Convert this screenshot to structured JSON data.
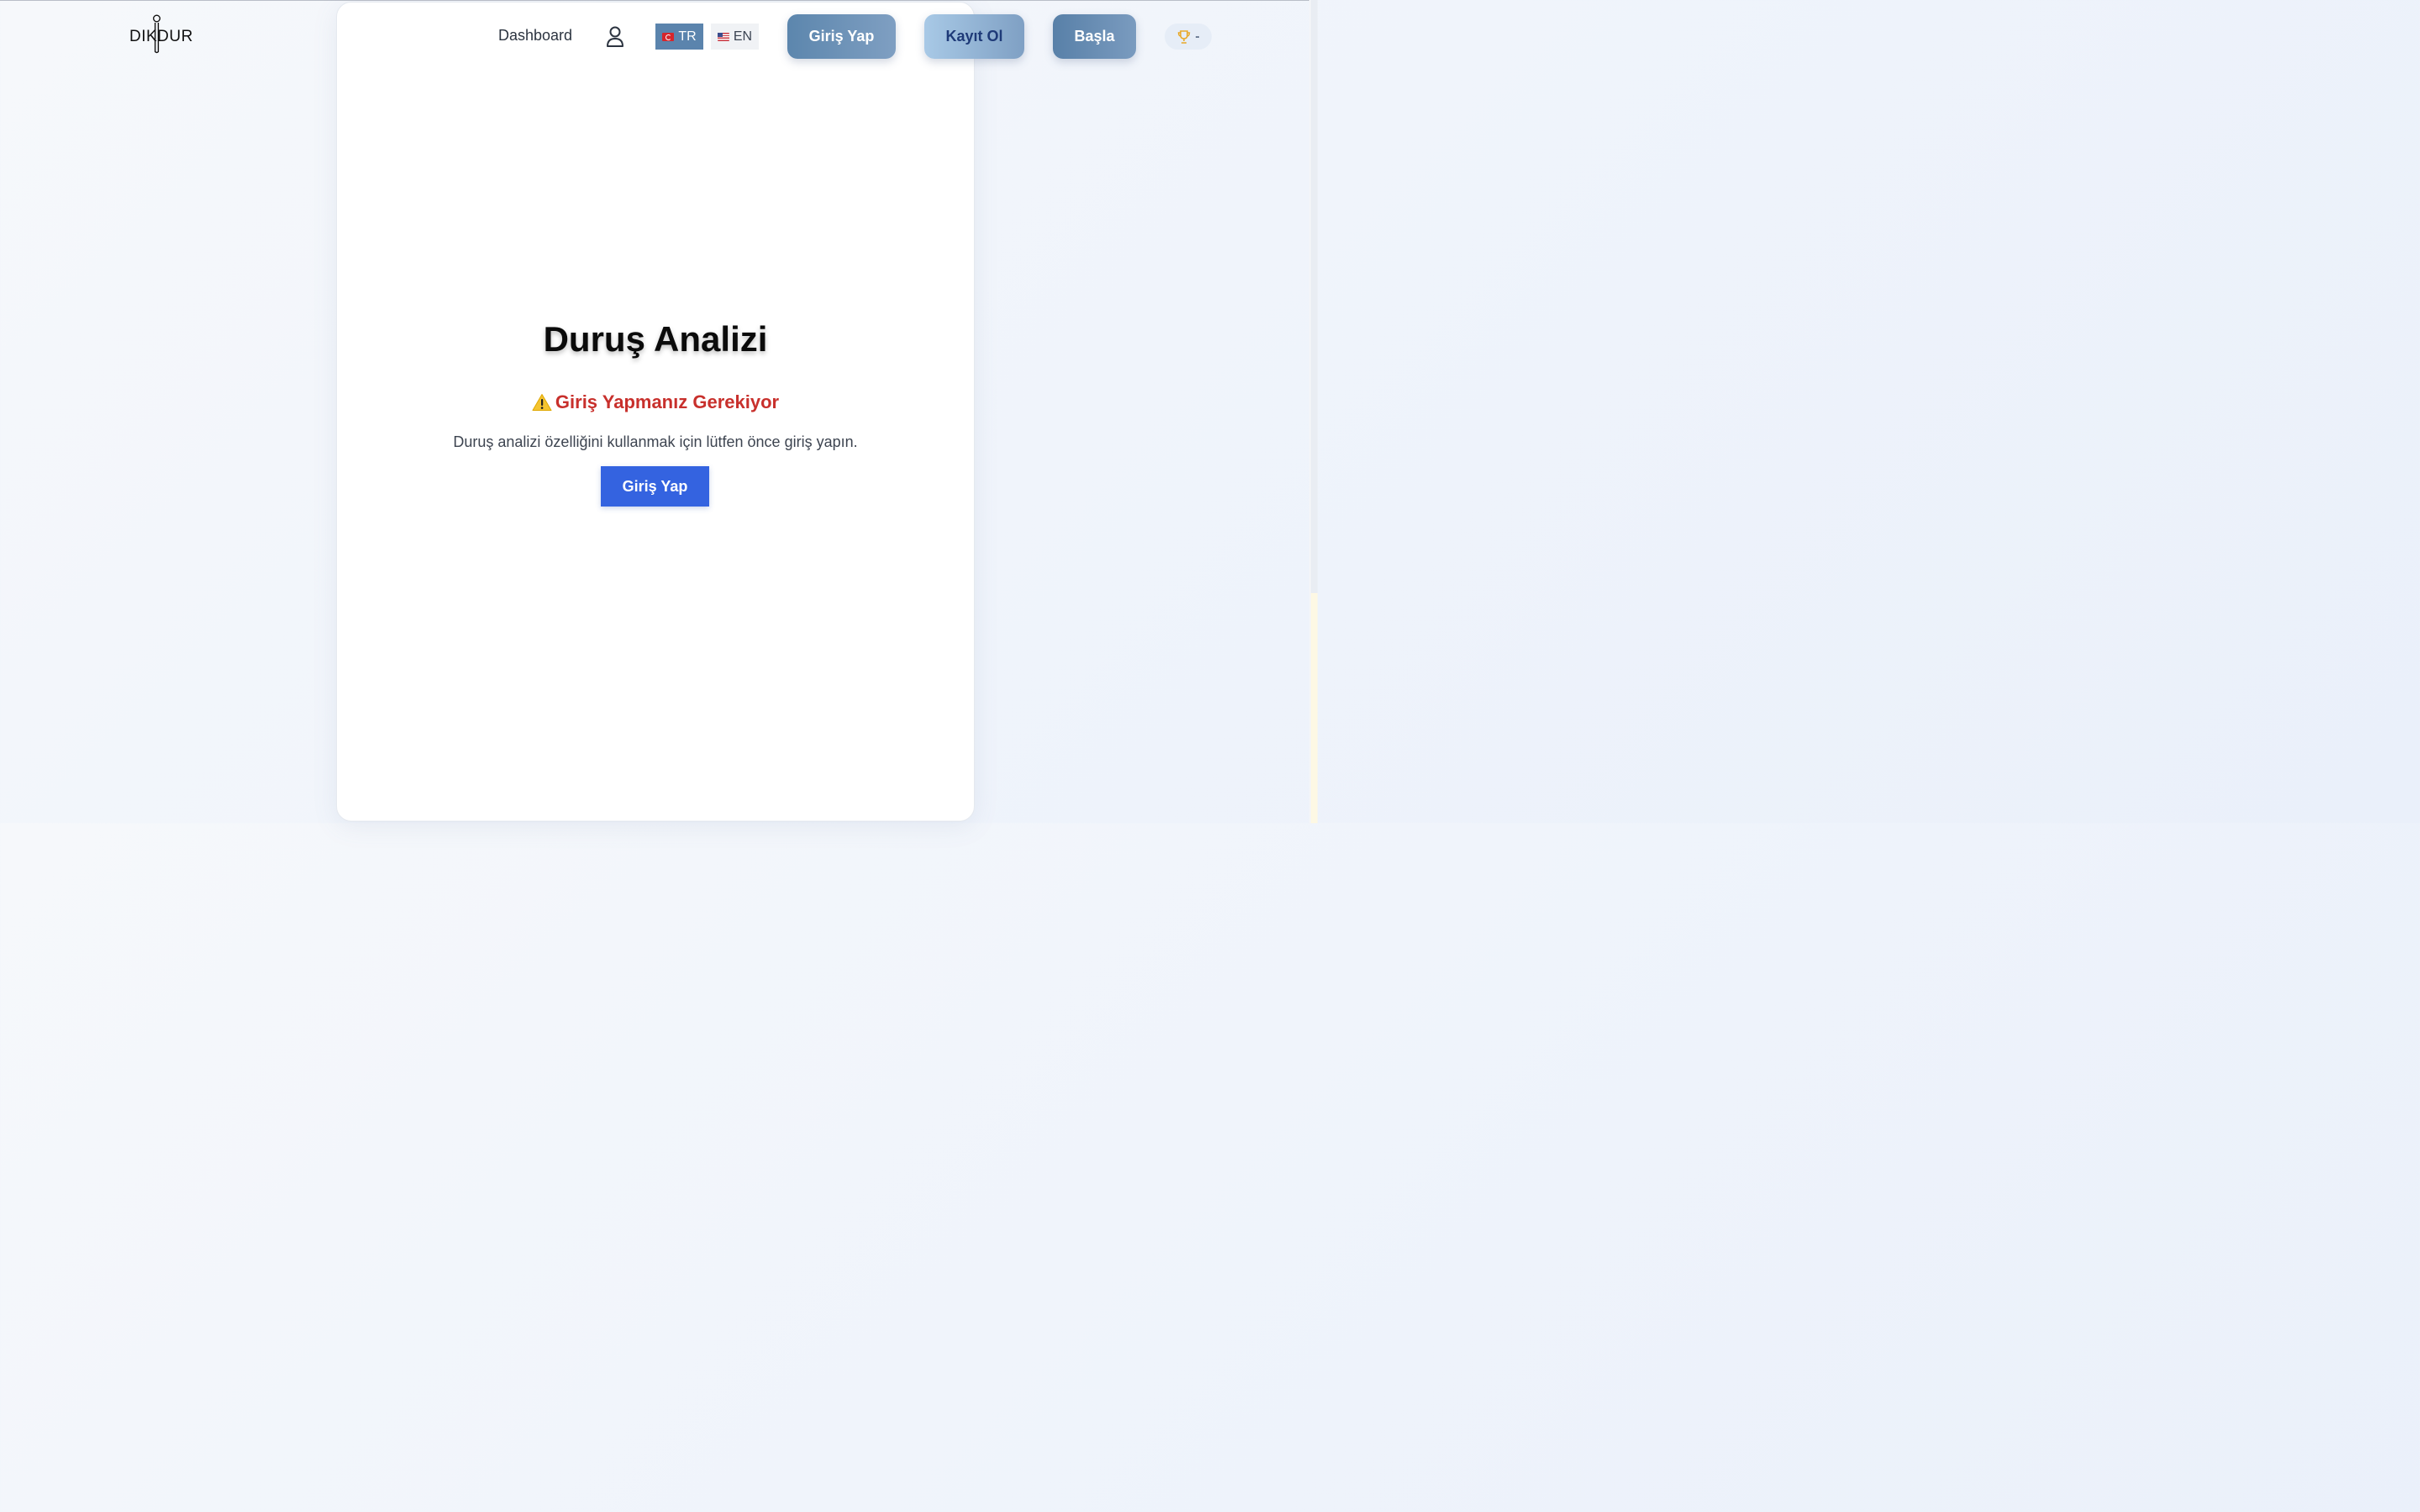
{
  "header": {
    "logo_text": "DIKDUR",
    "nav": {
      "dashboard_label": "Dashboard"
    },
    "languages": [
      {
        "code": "TR",
        "label": "TR",
        "flag": "turkey-flag-icon",
        "active": true
      },
      {
        "code": "EN",
        "label": "EN",
        "flag": "us-flag-icon",
        "active": false
      }
    ],
    "buttons": {
      "login_label": "Giriş Yap",
      "register_label": "Kayıt Ol",
      "start_label": "Başla"
    },
    "score": {
      "icon": "trophy-icon",
      "value": "-"
    }
  },
  "main": {
    "title": "Duruş Analizi",
    "warning": {
      "icon": "warning-icon",
      "text": "Giriş Yapmanız Gerekiyor"
    },
    "info": "Duruş analizi özelliğini kullanmak için lütfen önce giriş yapın.",
    "login_button_label": "Giriş Yap"
  },
  "colors": {
    "accent_blue": "#3463e0",
    "warning_red": "#c8302c",
    "nav_button_blue": "#5c86ad",
    "trophy_gold": "#e8a92a"
  }
}
